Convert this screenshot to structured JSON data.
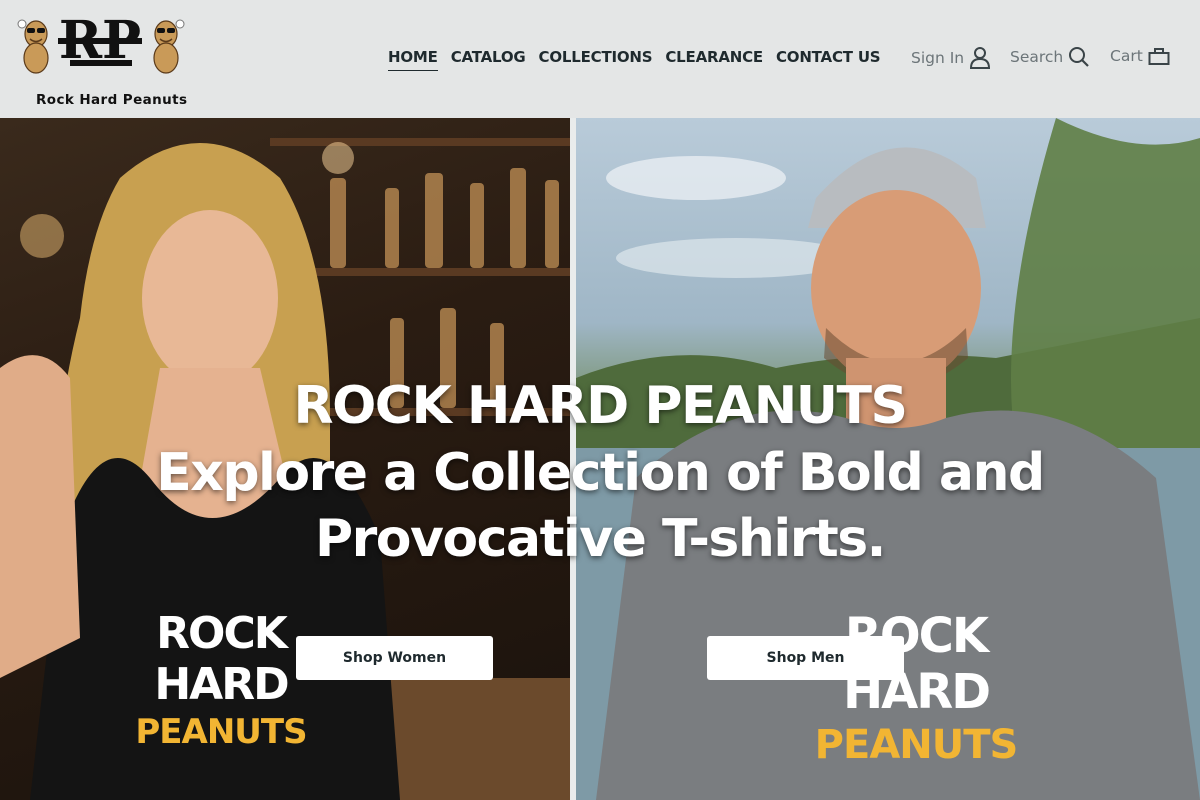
{
  "brand": {
    "name": "Rock Hard Peanuts"
  },
  "nav": {
    "items": [
      {
        "label": "HOME",
        "active": true
      },
      {
        "label": "CATALOG",
        "active": false
      },
      {
        "label": "COLLECTIONS",
        "active": false
      },
      {
        "label": "CLEARANCE",
        "active": false
      },
      {
        "label": "CONTACT US",
        "active": false
      }
    ]
  },
  "utility": {
    "sign_in": "Sign In",
    "search": "Search",
    "cart": "Cart"
  },
  "hero": {
    "title": "ROCK HARD PEANUTS",
    "subtitle_line1": "Explore a Collection of Bold and",
    "subtitle_line2": "Provocative T-shirts.",
    "shop_women": "Shop Women",
    "shop_men": "Shop Men",
    "left_shirt_line1": "ROCK HARD",
    "left_shirt_line2": "PEANUTS",
    "right_shirt_line1": "ROCK HARD",
    "right_shirt_line2": "PEANUTS"
  },
  "colors": {
    "header_bg": "#e4e6e6",
    "nav_text": "#1f2a2e",
    "util_text": "#6c7579",
    "shirt_accent": "#f2b533"
  },
  "icons": {
    "sign_in": "user-icon",
    "search": "search-icon",
    "cart": "shopping-bag-icon"
  }
}
